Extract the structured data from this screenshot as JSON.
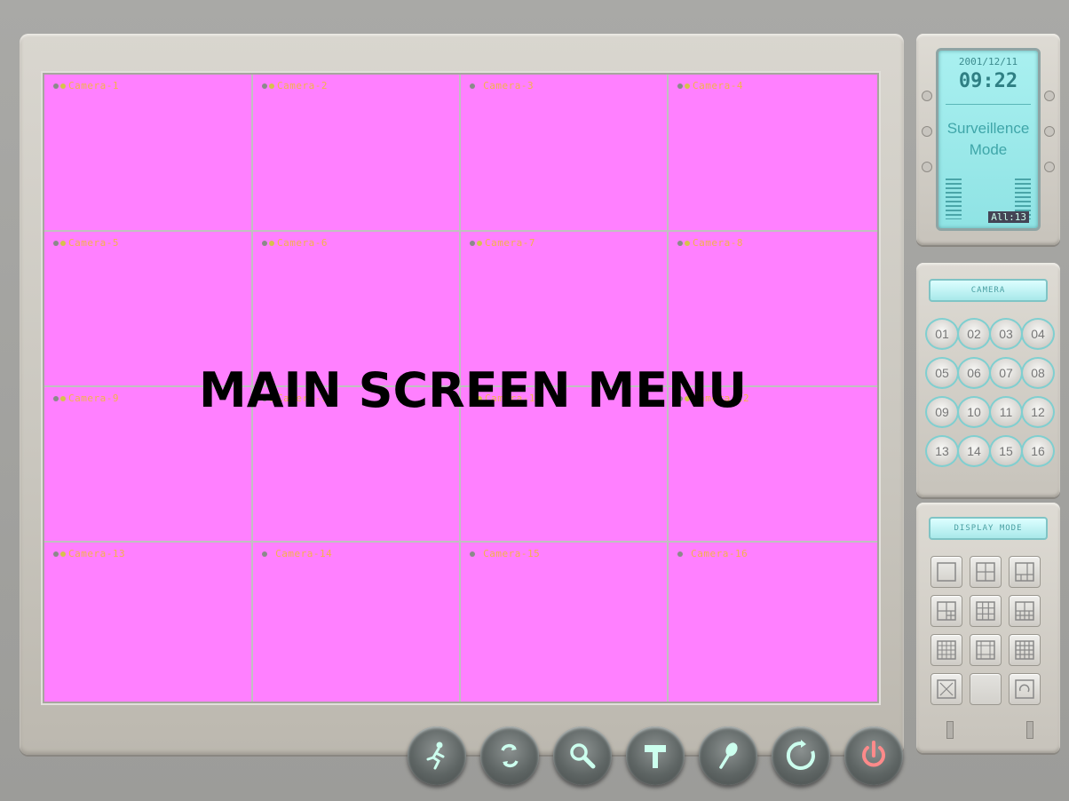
{
  "overlay": {
    "title": "MAIN SCREEN MENU"
  },
  "cameras": [
    "Camera-1",
    "Camera-2",
    "Camera-3",
    "Camera-4",
    "Camera-5",
    "Camera-6",
    "Camera-7",
    "Camera-8",
    "Camera-9",
    "Camera-10",
    "Camera-11",
    "Camera-12",
    "Camera-13",
    "Camera-14",
    "Camera-15",
    "Camera-16"
  ],
  "status": {
    "date": "2001/12/11",
    "time": "09:22",
    "mode_line1": "Surveillence",
    "mode_line2": "Mode",
    "badge": "All:13"
  },
  "camera_panel": {
    "label": "CAMERA",
    "channels": [
      "01",
      "02",
      "03",
      "04",
      "05",
      "06",
      "07",
      "08",
      "09",
      "10",
      "11",
      "12",
      "13",
      "14",
      "15",
      "16"
    ]
  },
  "display_mode": {
    "label": "DISPLAY MODE"
  },
  "toolbar": {
    "icons": [
      "running-man-icon",
      "cycle-icon",
      "search-icon",
      "hammer-icon",
      "microphone-icon",
      "refresh-icon",
      "power-icon"
    ]
  },
  "colors": {
    "screen": "#ff80ff",
    "lcd": "#9be8e8",
    "accent": "#7fcfd0",
    "power": "#e05a5a"
  }
}
